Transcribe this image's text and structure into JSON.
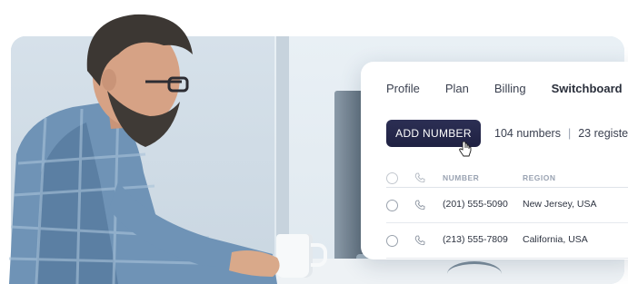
{
  "tabs": [
    {
      "label": "Profile"
    },
    {
      "label": "Plan"
    },
    {
      "label": "Billing"
    },
    {
      "label": "Switchboard",
      "active": true
    }
  ],
  "actions": {
    "add_number_label": "ADD NUMBER"
  },
  "summary": {
    "numbers": "104 numbers",
    "separator": "|",
    "registered": "23 registe"
  },
  "table": {
    "columns": [
      "NUMBER",
      "REGION"
    ],
    "rows": [
      {
        "number": "(201) 555-5090",
        "region": "New Jersey, USA"
      },
      {
        "number": "(213) 555-7809",
        "region": "California, USA"
      }
    ]
  },
  "colors": {
    "button": "#24264a",
    "text": "#3b4150",
    "muted": "#9aa3b2"
  },
  "icons": [
    "phone-icon",
    "radio-icon",
    "pointer-cursor-icon"
  ]
}
